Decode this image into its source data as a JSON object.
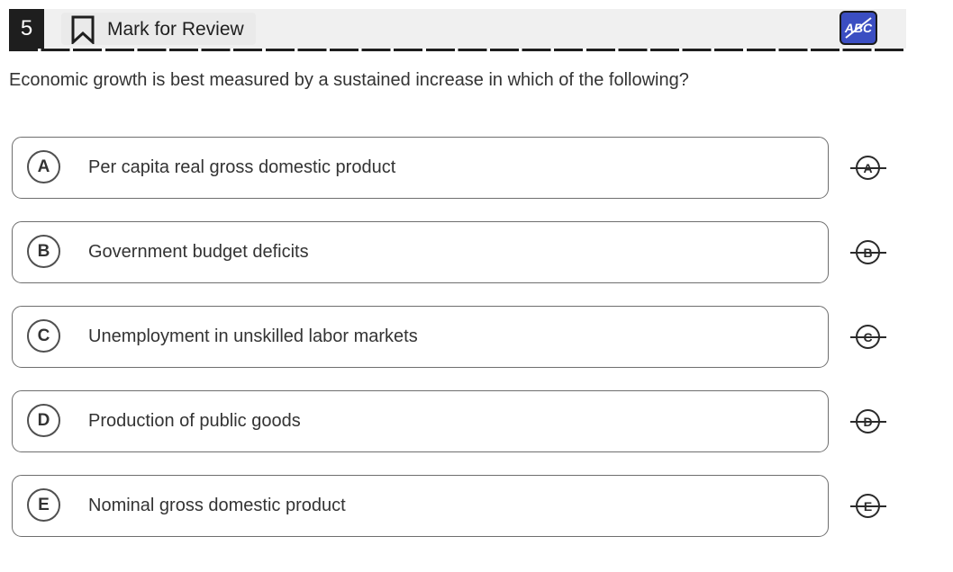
{
  "header": {
    "question_number": "5",
    "mark_for_review_label": "Mark for Review",
    "abc_label": "ABC"
  },
  "question": {
    "text": "Economic growth is best measured by a sustained increase in which of the following?"
  },
  "options": [
    {
      "letter": "A",
      "text": "Per capita real gross domestic product"
    },
    {
      "letter": "B",
      "text": "Government budget deficits"
    },
    {
      "letter": "C",
      "text": "Unemployment in unskilled labor markets"
    },
    {
      "letter": "D",
      "text": "Production of public goods"
    },
    {
      "letter": "E",
      "text": "Nominal gross domestic product"
    }
  ],
  "colors": {
    "accent": "#3b4ec2",
    "header_bg": "#f0f0f0",
    "dark": "#1e1e1e"
  },
  "icons": {
    "bookmark": "bookmark-icon",
    "abc": "strikethrough-abc-icon"
  }
}
